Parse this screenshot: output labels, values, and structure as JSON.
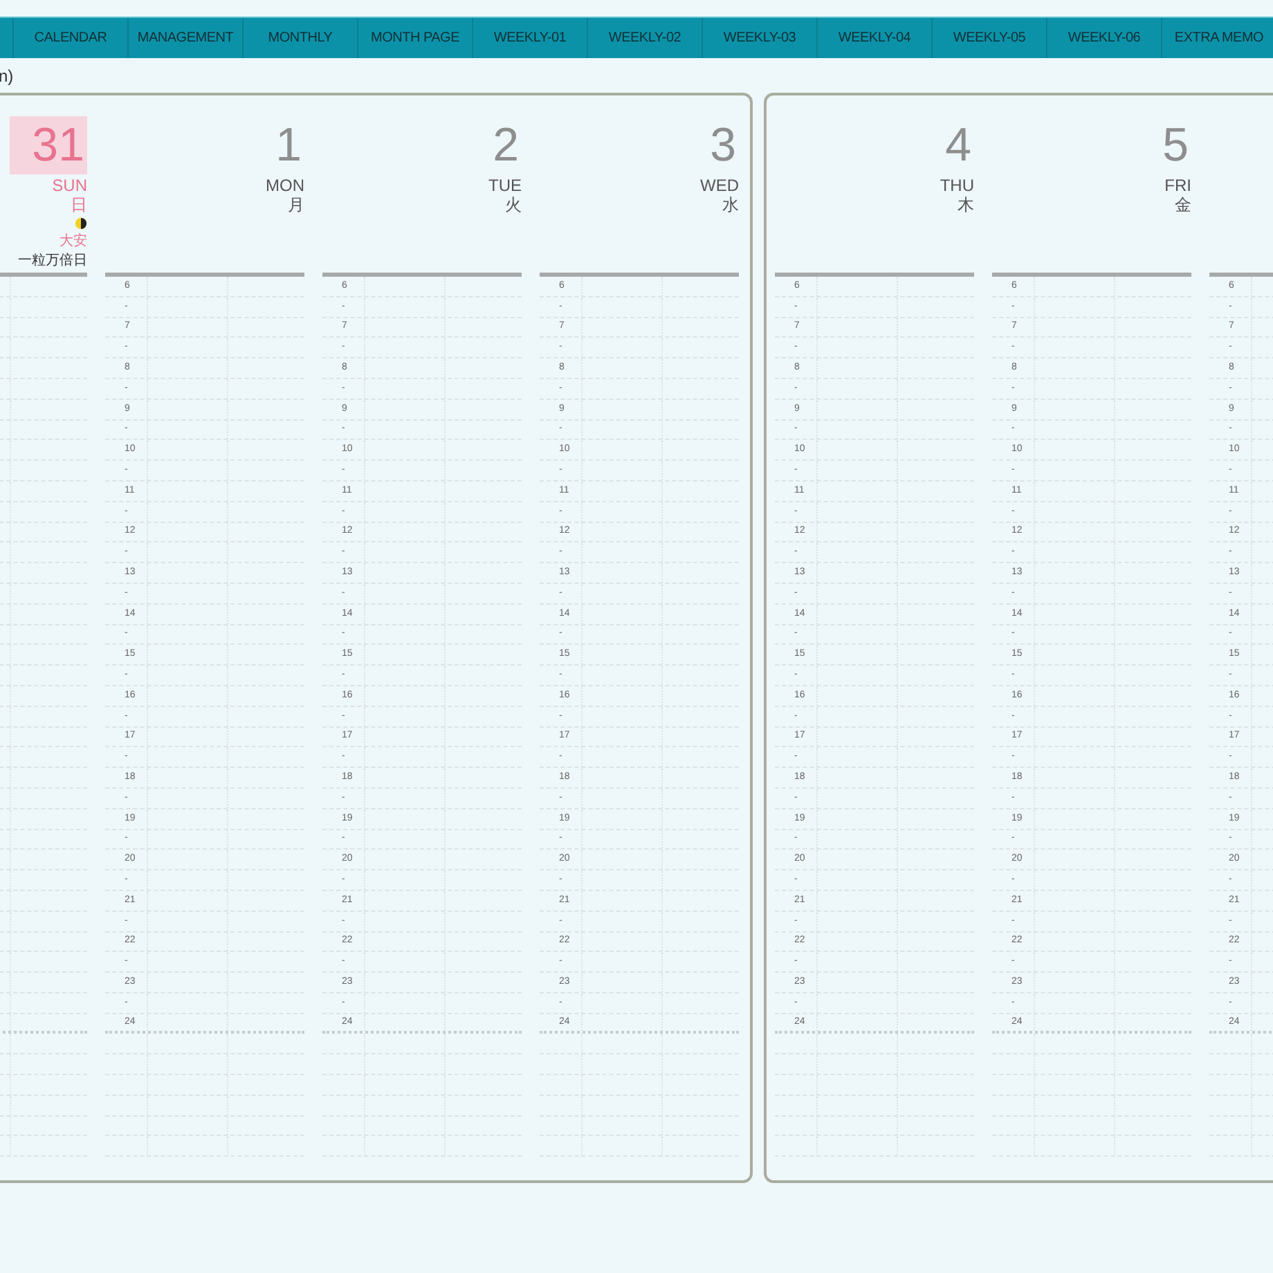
{
  "tabs": [
    {
      "label": "CALENDAR"
    },
    {
      "label": "MANAGEMENT"
    },
    {
      "label": "MONTHLY"
    },
    {
      "label": "MONTH PAGE"
    },
    {
      "label": "WEEKLY-01"
    },
    {
      "label": "WEEKLY-02"
    },
    {
      "label": "WEEKLY-03"
    },
    {
      "label": "WEEKLY-04"
    },
    {
      "label": "WEEKLY-05"
    },
    {
      "label": "WEEKLY-06"
    },
    {
      "label": "EXTRA MEMO"
    }
  ],
  "breadcrumb": "n)",
  "pages": [
    {
      "days": [
        {
          "kind": "sunday",
          "number": "31",
          "weekday": "SUN",
          "weekday_ja": "日",
          "moon": true,
          "rokuyo": "大安",
          "note": "一粒万倍日"
        },
        {
          "kind": "weekday",
          "number": "1",
          "weekday": "MON",
          "weekday_ja": "月",
          "hours": [
            "6",
            "-",
            "7",
            "-",
            "8",
            "-",
            "9",
            "-",
            "10",
            "-",
            "11",
            "-",
            "12",
            "-",
            "13",
            "-",
            "14",
            "-",
            "15",
            "-",
            "16",
            "-",
            "17",
            "-",
            "18",
            "-",
            "19",
            "-",
            "20",
            "-",
            "21",
            "-",
            "22",
            "-",
            "23",
            "-",
            "24"
          ]
        },
        {
          "kind": "weekday",
          "number": "2",
          "weekday": "TUE",
          "weekday_ja": "火",
          "hours": [
            "6",
            "-",
            "7",
            "-",
            "8",
            "-",
            "9",
            "-",
            "10",
            "-",
            "11",
            "-",
            "12",
            "-",
            "13",
            "-",
            "14",
            "-",
            "15",
            "-",
            "16",
            "-",
            "17",
            "-",
            "18",
            "-",
            "19",
            "-",
            "20",
            "-",
            "21",
            "-",
            "22",
            "-",
            "23",
            "-",
            "24"
          ]
        },
        {
          "kind": "weekday",
          "number": "3",
          "weekday": "WED",
          "weekday_ja": "水",
          "hours": [
            "6",
            "-",
            "7",
            "-",
            "8",
            "-",
            "9",
            "-",
            "10",
            "-",
            "11",
            "-",
            "12",
            "-",
            "13",
            "-",
            "14",
            "-",
            "15",
            "-",
            "16",
            "-",
            "17",
            "-",
            "18",
            "-",
            "19",
            "-",
            "20",
            "-",
            "21",
            "-",
            "22",
            "-",
            "23",
            "-",
            "24"
          ]
        }
      ]
    },
    {
      "days": [
        {
          "kind": "weekday",
          "number": "4",
          "weekday": "THU",
          "weekday_ja": "木",
          "hours": [
            "6",
            "-",
            "7",
            "-",
            "8",
            "-",
            "9",
            "-",
            "10",
            "-",
            "11",
            "-",
            "12",
            "-",
            "13",
            "-",
            "14",
            "-",
            "15",
            "-",
            "16",
            "-",
            "17",
            "-",
            "18",
            "-",
            "19",
            "-",
            "20",
            "-",
            "21",
            "-",
            "22",
            "-",
            "23",
            "-",
            "24"
          ]
        },
        {
          "kind": "weekday",
          "number": "5",
          "weekday": "FRI",
          "weekday_ja": "金",
          "hours": [
            "6",
            "-",
            "7",
            "-",
            "8",
            "-",
            "9",
            "-",
            "10",
            "-",
            "11",
            "-",
            "12",
            "-",
            "13",
            "-",
            "14",
            "-",
            "15",
            "-",
            "16",
            "-",
            "17",
            "-",
            "18",
            "-",
            "19",
            "-",
            "20",
            "-",
            "21",
            "-",
            "22",
            "-",
            "23",
            "-",
            "24"
          ]
        },
        {
          "kind": "weekday",
          "hours": [
            "6",
            "-",
            "7",
            "-",
            "8",
            "-",
            "9",
            "-",
            "10",
            "-",
            "11",
            "-",
            "12",
            "-",
            "13",
            "-",
            "14",
            "-",
            "15",
            "-",
            "16",
            "-",
            "17",
            "-",
            "18",
            "-",
            "19",
            "-",
            "20",
            "-",
            "21",
            "-",
            "22",
            "-",
            "23",
            "-",
            "24"
          ]
        }
      ]
    }
  ]
}
